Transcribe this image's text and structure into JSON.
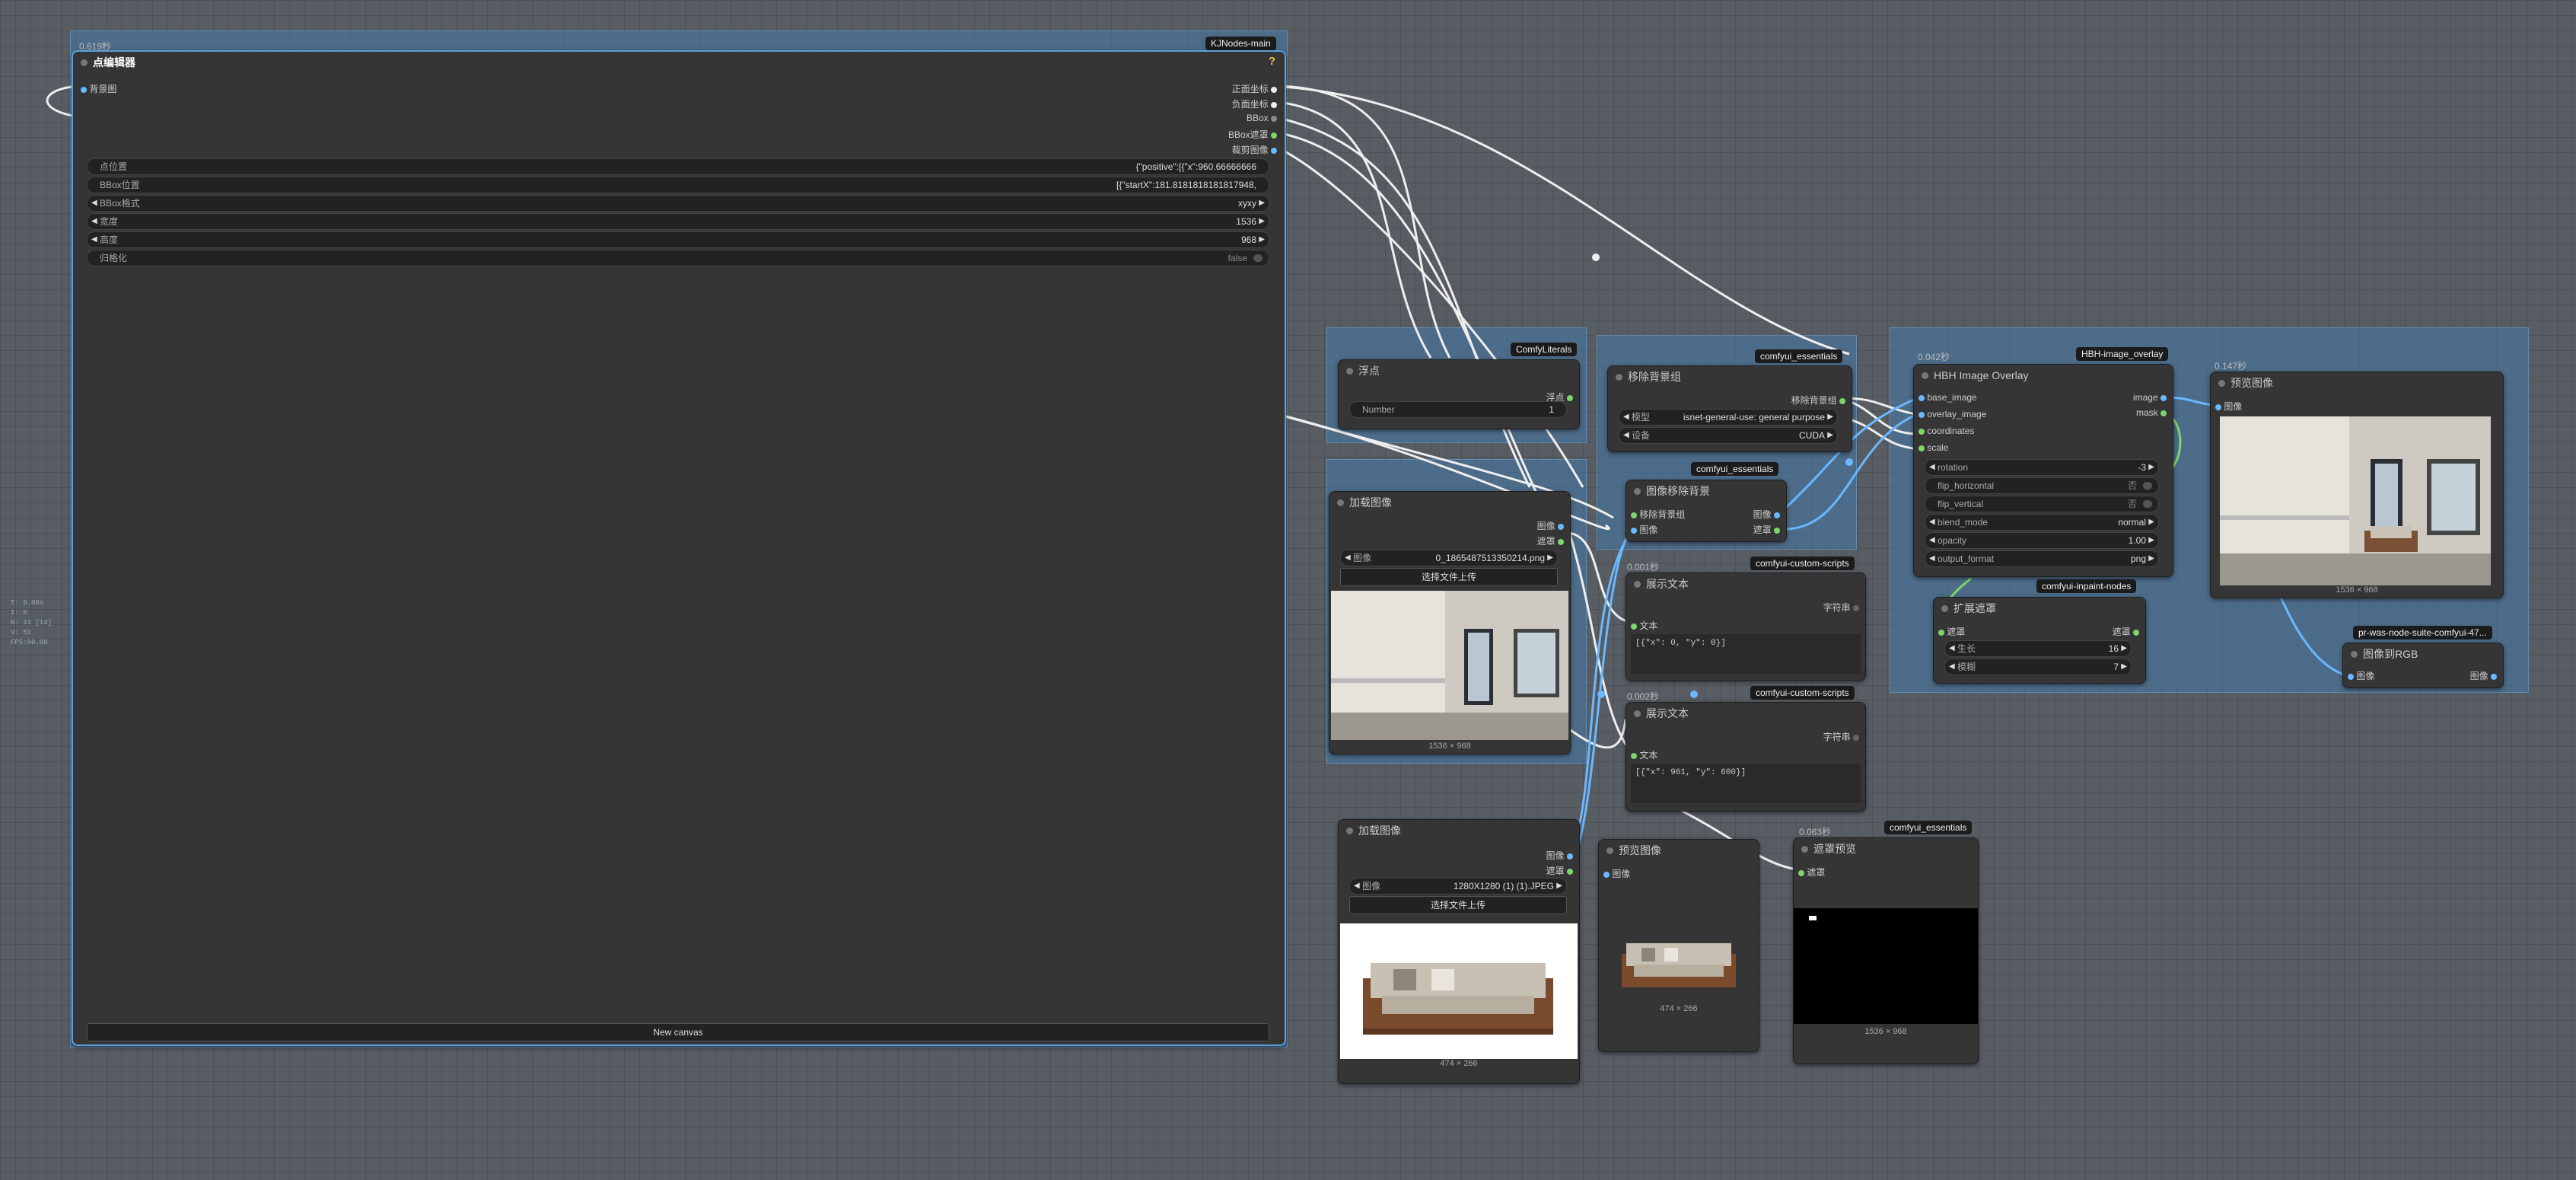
{
  "stats": [
    "T: 0.00s",
    "I: 0",
    "N: 14 [14]",
    "V: 51",
    "FPS:50.00"
  ],
  "point_editor": {
    "time": "0.619秒",
    "tag": "KJNodes-main",
    "title": "点编辑器",
    "input_bg": "背景图",
    "outputs": [
      "正面坐标",
      "负面坐标",
      "BBox",
      "BBox遮罩",
      "裁剪图像"
    ],
    "widgets": [
      {
        "label": "点位置",
        "value": "{\"positive\":[{\"x\":960.66666666"
      },
      {
        "label": "BBox位置",
        "value": "[{\"startX\":181.8181818181817948,"
      },
      {
        "label": "BBox格式",
        "value": "xyxy"
      },
      {
        "label": "宽度",
        "value": "1536"
      },
      {
        "label": "高度",
        "value": "968"
      },
      {
        "label": "归格化",
        "value": "false"
      }
    ],
    "new_canvas": "New canvas"
  },
  "float_node": {
    "tag": "ComfyLiterals",
    "title": "浮点",
    "output": "浮点",
    "widget_label": "Number",
    "widget_value": "1"
  },
  "load_image_1": {
    "title": "加载图像",
    "out_image": "图像",
    "out_mask": "遮罩",
    "widget_label": "图像",
    "widget_value": "0_1865487513350214.png",
    "upload": "选择文件上传",
    "dims": "1536 × 968"
  },
  "remove_bg_session": {
    "tag": "comfyui_essentials",
    "title": "移除背景组",
    "output": "移除背景组",
    "model_label": "模型",
    "model_value": "isnet-general-use: general purpose",
    "device_label": "设备",
    "device_value": "CUDA"
  },
  "image_remove_bg": {
    "tag": "comfyui_essentials",
    "title": "图像移除背景",
    "in_session": "移除背景组",
    "in_image": "图像",
    "out_image": "图像",
    "out_mask": "遮罩"
  },
  "show_text_1": {
    "time": "0.001秒",
    "tag": "comfyui-custom-scripts",
    "title": "展示文本",
    "out": "字符串",
    "in": "文本",
    "text": "[{\"x\": 0, \"y\": 0}]"
  },
  "show_text_2": {
    "time": "0.002秒",
    "tag": "comfyui-custom-scripts",
    "title": "展示文本",
    "out": "字符串",
    "in": "文本",
    "text": "[{\"x\": 961, \"y\": 600}]"
  },
  "hbh_overlay": {
    "time": "0.042秒",
    "tag": "HBH-image_overlay",
    "title": "HBH Image Overlay",
    "inputs": [
      "base_image",
      "overlay_image",
      "coordinates",
      "scale"
    ],
    "outputs": [
      "image",
      "mask"
    ],
    "widgets": [
      {
        "label": "rotation",
        "value": "-3"
      },
      {
        "label": "flip_horizontal",
        "value": "否"
      },
      {
        "label": "flip_vertical",
        "value": "否"
      },
      {
        "label": "blend_mode",
        "value": "normal"
      },
      {
        "label": "opacity",
        "value": "1.00"
      },
      {
        "label": "output_format",
        "value": "png"
      }
    ]
  },
  "preview_main": {
    "time": "0.147秒",
    "title": "预览图像",
    "in": "图像",
    "dims": "1536 × 968"
  },
  "expand_mask": {
    "tag": "comfyui-inpaint-nodes",
    "title": "扩展遮罩",
    "in": "遮罩",
    "out": "遮罩",
    "widgets": [
      {
        "label": "生长",
        "value": "16"
      },
      {
        "label": "模糊",
        "value": "7"
      }
    ]
  },
  "image_to_rgb": {
    "tag": "pr-was-node-suite-comfyui-47...",
    "title": "图像到RGB",
    "in": "图像",
    "out": "图像"
  },
  "load_image_2": {
    "title": "加载图像",
    "out_image": "图像",
    "out_mask": "遮罩",
    "widget_label": "图像",
    "widget_value": "1280X1280 (1) (1).JPEG",
    "upload": "选择文件上传",
    "dims": "474 × 266"
  },
  "preview_sofa": {
    "title": "预览图像",
    "in": "图像",
    "dims": "474 × 266"
  },
  "mask_preview": {
    "time": "0.063秒",
    "tag": "comfyui_essentials",
    "title": "遮罩预览",
    "in": "遮罩",
    "dims": "1536 × 968"
  }
}
